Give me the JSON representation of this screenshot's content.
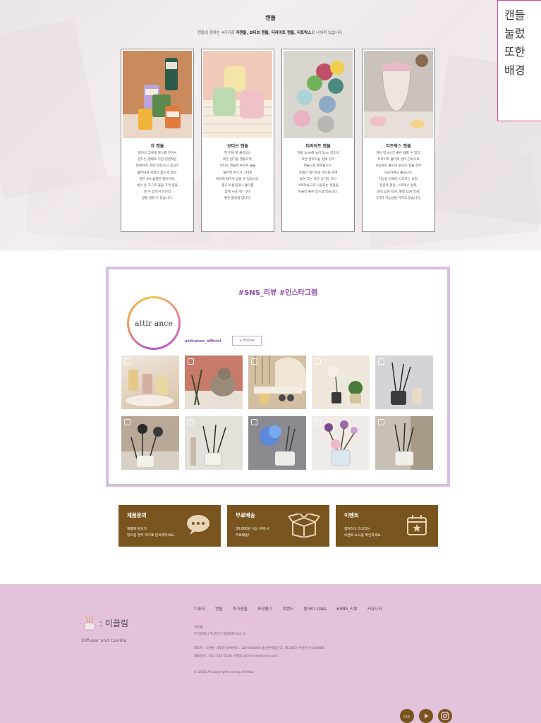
{
  "candle_section": {
    "title": "캔들",
    "subtitle_pre": "캔들의 종류는 4가지로 ",
    "subtitle_bold": "자캔들, 보티브 캔들, 티라이트 캔들, 티트락스",
    "subtitle_post": "로 나눠져 있습니다.",
    "cards": [
      {
        "name": "자 캔들",
        "desc": "병이나 그릇에 왁스를 부어서\n만드는 형태로 가장 일반적인\n형태이며, 제일 안전하고 중심이\n흘러내릴 위험이 없는게 장점.\n같은 비누숲향된 향초이며,\n비너 등 가구로 불을 가려 향을\n낼 수 있어서 안전적\n향을 발휘 수 있습니다."
      },
      {
        "name": "보티브 캔들",
        "desc": "한 번에 쭉 올라오는\n작은 원기둥 캔들이며,\n보티브 캔들에 투넣은 불을\n붙이면 왁스가 그대로\n바닥에 떨어서 곧을 수 있습니다.\n별도의 받침대나 홀더를\n함께 사용하는 것이\n좋은 활용법 입니다."
      },
      {
        "name": "티라이트 캔들",
        "desc": "지름 3cm에 높이 2cm 정도의\n작은 알루미늄 컵에 담겨\n캔들으로 판매됩니다.\n카페나 레스토랑 테이블 위에\n놓여 있는 작은 초기도 하나\n아로마용으로 사용되는 캔들을\n떠올리 볼수 있으셨 있습니다."
      },
      {
        "name": "티트락스 캔들",
        "desc": "겨당 약 4시간 좋은 때를 수 있다.\n티라이트 홀더에 넣어 단독으로\n사용해도 좋으며,원하는 향을 섞어\n사용하여도 좋습니다.\n기능성 아로마 시리즈는 숙면,\n집중력 향상, 스트레스 완화,\n중독 넘쳐 적게, 벌레 넘쳐 적게,\n5가지 기능성을 가지고 있습니다."
      }
    ]
  },
  "tooltip": {
    "lines": [
      "캔들",
      "눌렀",
      "또한",
      "배경"
    ]
  },
  "sns": {
    "title": "#SNS_리뷰 #인스타그램",
    "logo_text": "attir ance",
    "handle": "attirance_official",
    "follow_label": "+ Follow"
  },
  "info_boxes": [
    {
      "title": "제품문의",
      "desc": "제품에 문의가\n있으실 경우 여기로 문의해주세요.",
      "icon": "chat-bubble-icon"
    },
    {
      "title": "무료배송",
      "desc": "30,000원 이상 구매 시\n무료배송!",
      "icon": "box-icon"
    },
    {
      "title": "이벤트",
      "desc": "참여하고 하고있는\n이벤트 소식을 확인하세요.",
      "icon": "calendar-star-icon"
    }
  ],
  "footer": {
    "brand_name": ": 이끌림",
    "brand_sub": "Diffuser and Candle",
    "nav": [
      "디퓨저",
      "캔들",
      "추가종들",
      "포장용기",
      "브랜드",
      "원데이 class",
      "#SNS_리뷰",
      "커뮤니티"
    ],
    "info_lines": [
      "이끌림",
      "부산광역시 부산진구 중앙대로 111-4",
      "대표자 : 오경빈    사업자 등록번호 : 120-094056    통신판매업신고: 제 2022-부산진구-03688호",
      "대표번호 : 051-321-2184    이메일 attirance@naver.com",
      "© 2022 All copyrights are by SinHub."
    ],
    "social": [
      "talk-icon",
      "youtube-icon",
      "instagram-icon"
    ]
  },
  "colors": {
    "footer_bg": "#e5c2dc",
    "info_box_bg": "#7a541e",
    "sns_border": "#d9bde1",
    "sns_accent": "#8c4aa3",
    "tooltip_border": "#d64d90"
  }
}
